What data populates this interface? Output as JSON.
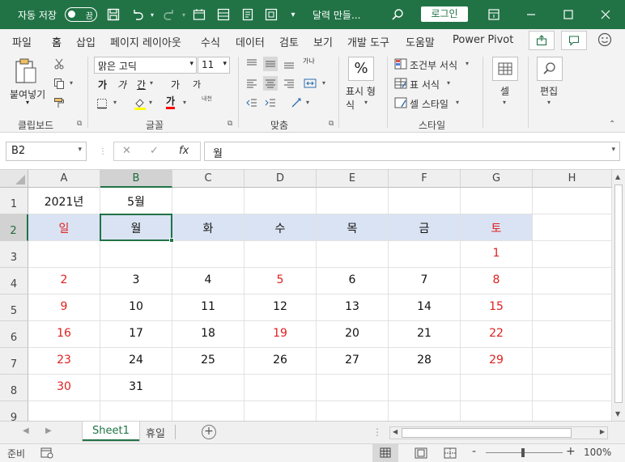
{
  "titlebar": {
    "autosave_label": "자동 저장",
    "autosave_state": "끔",
    "doc_title": "달력 만들...",
    "login_label": "로그인"
  },
  "menu": {
    "tabs": [
      "파일",
      "홈",
      "삽입",
      "페이지 레이아웃",
      "수식",
      "데이터",
      "검토",
      "보기",
      "개발 도구",
      "도움말",
      "Power Pivot"
    ],
    "active_tab": "홈"
  },
  "ribbon": {
    "clipboard": {
      "paste_label": "붙여넣기",
      "group_label": "클립보드"
    },
    "font": {
      "font_name": "맑은 고딕",
      "font_size": "11",
      "group_label": "글꼴",
      "bold": "가",
      "italic": "가",
      "underline": "간",
      "grow": "가",
      "shrink": "가",
      "fontcolor": "가",
      "phonetic": "내천"
    },
    "alignment": {
      "group_label": "맞춤",
      "wrap": "가나"
    },
    "number": {
      "format_label": "표시 형식",
      "percent": "%"
    },
    "styles": {
      "conditional": "조건부 서식",
      "table": "표 서식",
      "cell_style": "셀 스타일",
      "group_label": "스타일"
    },
    "cells": {
      "label": "셀"
    },
    "editing": {
      "label": "편집"
    }
  },
  "formula_bar": {
    "name_box": "B2",
    "content": "월",
    "fx": "fx"
  },
  "grid": {
    "columns": [
      "A",
      "B",
      "C",
      "D",
      "E",
      "F",
      "G",
      "H"
    ],
    "rows": [
      "1",
      "2",
      "3",
      "4",
      "5",
      "6",
      "7",
      "8",
      "9"
    ],
    "selected_cell": "B2",
    "cells": {
      "r1": [
        "2021년",
        "5월",
        "",
        "",
        "",
        "",
        "",
        ""
      ],
      "r2": [
        "일",
        "월",
        "화",
        "수",
        "목",
        "금",
        "토",
        ""
      ],
      "r3": [
        "",
        "",
        "",
        "",
        "",
        "",
        "1",
        ""
      ],
      "r4": [
        "2",
        "3",
        "4",
        "5",
        "6",
        "7",
        "8",
        ""
      ],
      "r5": [
        "9",
        "10",
        "11",
        "12",
        "13",
        "14",
        "15",
        ""
      ],
      "r6": [
        "16",
        "17",
        "18",
        "19",
        "20",
        "21",
        "22",
        ""
      ],
      "r7": [
        "23",
        "24",
        "25",
        "26",
        "27",
        "28",
        "29",
        ""
      ],
      "r8": [
        "30",
        "31",
        "",
        "",
        "",
        "",
        "",
        ""
      ],
      "r9": [
        "",
        "",
        "",
        "",
        "",
        "",
        "",
        ""
      ]
    },
    "red_cells": [
      "A2",
      "G2",
      "G3",
      "A4",
      "D4",
      "G4",
      "A5",
      "G5",
      "A6",
      "D6",
      "G6",
      "A7",
      "G7",
      "A8"
    ],
    "header_row_fill": "#dae3f3",
    "red_color": "#e02020"
  },
  "sheets": {
    "tabs": [
      "Sheet1",
      "휴일"
    ],
    "active": "Sheet1"
  },
  "statusbar": {
    "ready": "준비",
    "zoom": "100%",
    "minus": "-",
    "plus": "+"
  },
  "colors": {
    "brand": "#217346",
    "title_text": "#ffffff"
  }
}
